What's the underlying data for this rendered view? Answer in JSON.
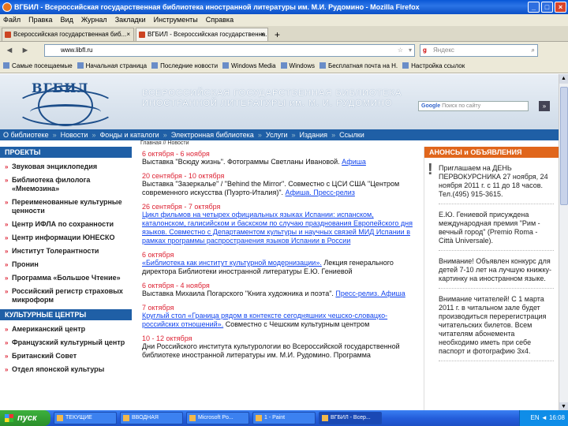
{
  "window": {
    "title": "ВГБИЛ - Всероссийская государственная библиотека иностранной литературы им. М.И. Рудомино - Mozilla Firefox",
    "controls": [
      "_",
      "□",
      "×"
    ]
  },
  "menu": [
    "Файл",
    "Правка",
    "Вид",
    "Журнал",
    "Закладки",
    "Инструменты",
    "Справка"
  ],
  "tabs": [
    {
      "label": "Всероссийская государственная биб...",
      "close": "×"
    },
    {
      "label": "ВГБИЛ - Всероссийская государственна...",
      "close": "×"
    }
  ],
  "new_tab": "+",
  "nav": {
    "back": "◄",
    "forward": "►",
    "url": "www.libfl.ru",
    "star": "☆",
    "go": "▾",
    "search_engine": "g",
    "search_placeholder": "Яндекс",
    "search_btn": "⌕"
  },
  "bookmarks": [
    "Самые посещаемые",
    "Начальная страница",
    "Последние новости",
    "Windows Media",
    "Windows",
    "Бесплатная почта на Н.",
    "Настройка ссылок"
  ],
  "site": {
    "logo_text": "ВГБИЛ",
    "name_line1": "ВСЕРОССИЙСКАЯ ГОСУДАРСТВЕННАЯ БИБЛИОТЕКА",
    "name_line2": "ИНОСТРАННОЙ ЛИТЕРАТУРЫ им. М. И. РУДОМИНО",
    "search_brand": "Google",
    "search_placeholder": "Поиск по сайту",
    "search_btn": "»",
    "breadcrumb": "Главная // Новости"
  },
  "mainnav": [
    "О библиотеке",
    "Новости",
    "Фонды и каталоги",
    "Электронная библиотека",
    "Услуги",
    "Издания",
    "Ссылки"
  ],
  "left": {
    "projects_title": "ПРОЕКТЫ",
    "projects": [
      "Звуковая энциклопедия",
      "Библиотека филолога «Мнемозина»",
      "Переименованные культурные ценности",
      "Центр ИФЛА по сохранности",
      "Центр информации ЮНЕСКО",
      "Институт Толерантности",
      "Пронин",
      "Программа «Большое Чтение»",
      "Российский регистр страховых микроформ"
    ],
    "centers_title": "КУЛЬТУРНЫЕ ЦЕНТРЫ",
    "centers": [
      "Американский центр",
      "Французский культурный центр",
      "Британский Совет",
      "Отдел японской культуры"
    ]
  },
  "news": [
    {
      "date": "6 октября - 6 ноября",
      "text": "Выставка \"Всюду жизнь\". Фотограммы Светланы Ивановой.",
      "link": "Афиша"
    },
    {
      "date": "20 сентября - 10 октября",
      "text": "Выставка \"Зазеркалье\" / \"Behind the Mirror\". Совместно с ЦСИ США \"Центром современного искусства (Пуэрто-Италия)\".",
      "link": "Афиша. Пресс-релиз"
    },
    {
      "date": "26 сентября - 7 октября",
      "text": "",
      "link": "Цикл фильмов на четырех официальных языках Испании: испанском, каталонском, галисийском и баскском по случаю празднования Европейского дня языков. Совместно с Департаментом культуры и научных связей МИД Испании в рамках программы распространения языков Испании в России"
    },
    {
      "date": "6 октября",
      "text": "Лекция генерального директора Библиотеки иностранной литературы Е.Ю. Гениевой",
      "link": "«Библиотека как институт культурной модернизации»."
    },
    {
      "date": "6 октября - 4 ноября",
      "text": "Выставка Михаила Погарского \"Книга художника и поэта\".",
      "link": "Пресс-релиз. Афиша"
    },
    {
      "date": "7 октября",
      "text": "Совместно с Чешским культурным центром",
      "link": "Круглый стол «Граница рядом в контексте сегодняшних чешско-словацко-российских отношений»."
    },
    {
      "date": "10 - 12 октября",
      "text": "Дни Российского института культурологии во Всероссийской государственной библиотеке иностранной литературы им. М.И. Рудомино. Программа",
      "link": ""
    }
  ],
  "right": {
    "title": "АНОНСЫ и ОБЪЯВЛЕНИЯ",
    "exclaim": "!",
    "blocks": [
      {
        "text": "Приглашаем на ДЕНЬ ПЕРВОКУРСНИКА 27 ноября, 24 ноября 2011 г. с 11 до 18 часов. Тел.(495) 915-3615.",
        "link": ""
      },
      {
        "text": "Е.Ю. Гениевой присуждена международная премия \"Рим - вечный город\" (Premio Roma - Città Universale).",
        "link": ""
      },
      {
        "text": "Внимание! Объявлен конкурс для детей 7-10 лет на лучшую книжку-картинку на иностранном языке.",
        "link": ""
      },
      {
        "text": "Внимание читателей! С 1 марта 2011 г. в читальном зале будет производиться перерегистрация читательских билетов. Всем читателям абонемента необходимо иметь при себе паспорт и фотографию 3x4.",
        "link": ""
      }
    ]
  },
  "taskbar": {
    "start": "пуск",
    "items": [
      "ТЕКУЩИЕ",
      "ВВОДНАЯ",
      "Microsoft Po...",
      "1 - Paint",
      "ВГБИЛ - Всер..."
    ],
    "clock": "EN ◄ 16:08"
  }
}
